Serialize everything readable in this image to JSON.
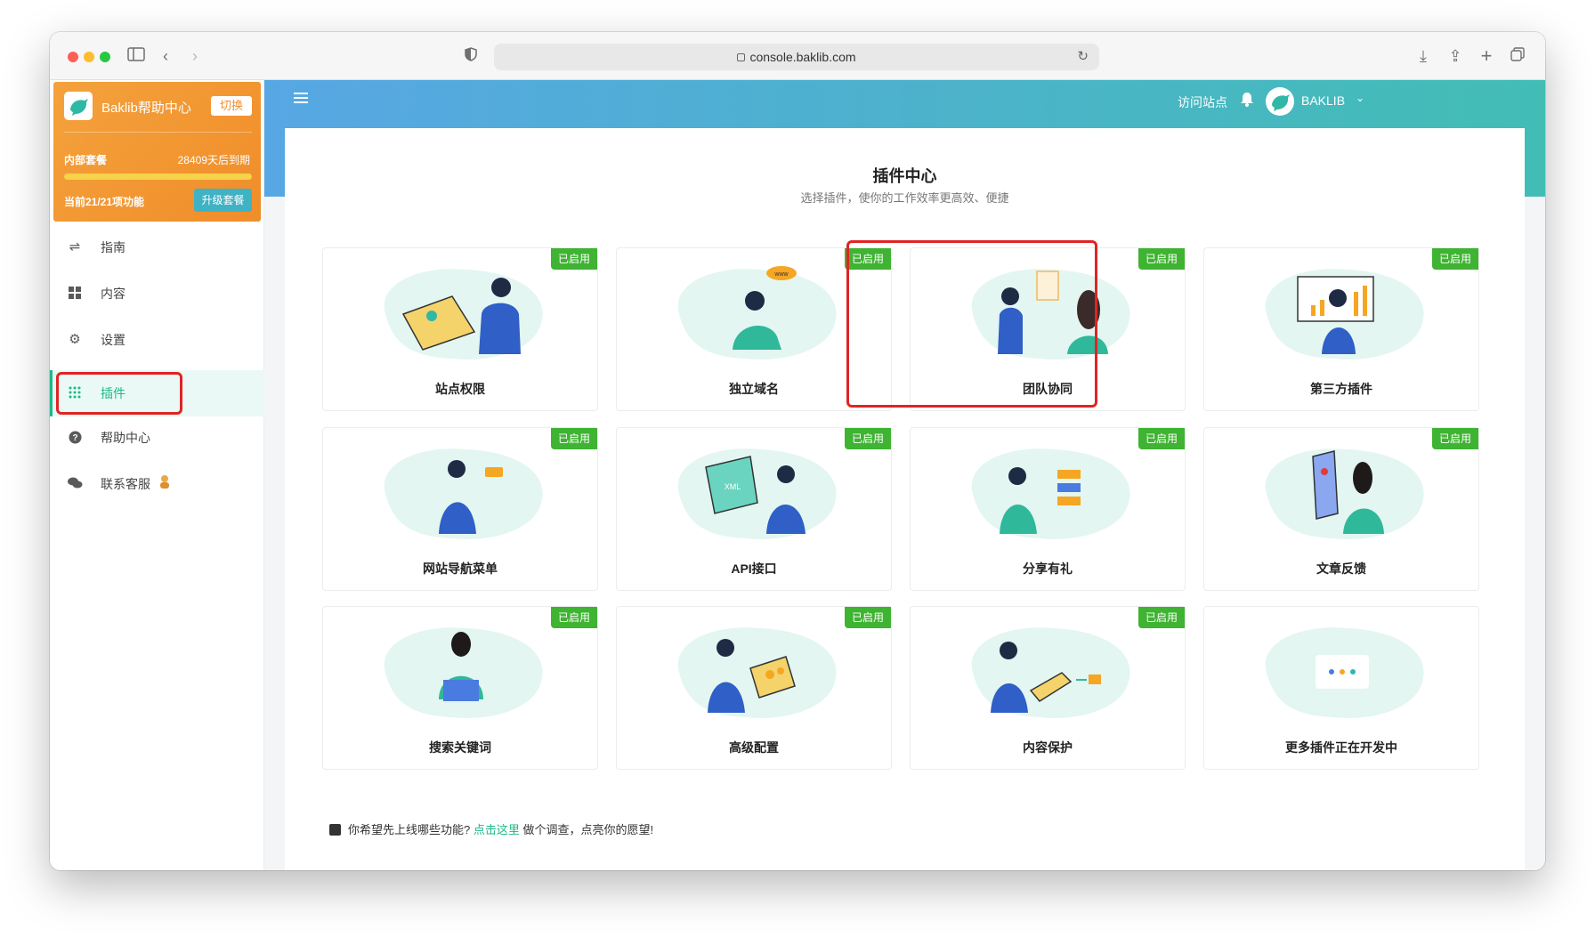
{
  "browser": {
    "url": "console.baklib.com"
  },
  "sidebar": {
    "brand": "Baklib帮助中心",
    "switch_label": "切换",
    "plan": "内部套餐",
    "expire": "28409天后到期",
    "features": "当前21/21项功能",
    "upgrade_label": "升级套餐",
    "items": [
      {
        "label": "指南",
        "icon": "signpost-icon"
      },
      {
        "label": "内容",
        "icon": "grid-icon"
      },
      {
        "label": "设置",
        "icon": "gear-icon"
      },
      {
        "label": "插件",
        "icon": "apps-icon"
      },
      {
        "label": "帮助中心",
        "icon": "question-icon"
      },
      {
        "label": "联系客服",
        "icon": "chat-icon"
      }
    ]
  },
  "header": {
    "visit_site": "访问站点",
    "username": "BAKLIB"
  },
  "main": {
    "title": "插件中心",
    "subtitle": "选择插件，使你的工作效率更高效、便捷",
    "badge_label": "已启用",
    "plugins": [
      {
        "name": "站点权限",
        "enabled": true
      },
      {
        "name": "独立域名",
        "enabled": true
      },
      {
        "name": "团队协同",
        "enabled": true
      },
      {
        "name": "第三方插件",
        "enabled": true
      },
      {
        "name": "网站导航菜单",
        "enabled": true
      },
      {
        "name": "API接口",
        "enabled": true
      },
      {
        "name": "分享有礼",
        "enabled": true
      },
      {
        "name": "文章反馈",
        "enabled": true
      },
      {
        "name": "搜索关键词",
        "enabled": true
      },
      {
        "name": "高级配置",
        "enabled": true
      },
      {
        "name": "内容保护",
        "enabled": true
      },
      {
        "name": "更多插件正在开发中",
        "enabled": false
      }
    ],
    "footer": {
      "prefix": "你希望先上线哪些功能?",
      "link": "点击这里",
      "suffix": "做个调查，点亮你的愿望!"
    }
  },
  "colors": {
    "accent": "#20b789",
    "badge": "#3fb332",
    "promo": "#f08d2a",
    "highlight": "#e02424"
  }
}
